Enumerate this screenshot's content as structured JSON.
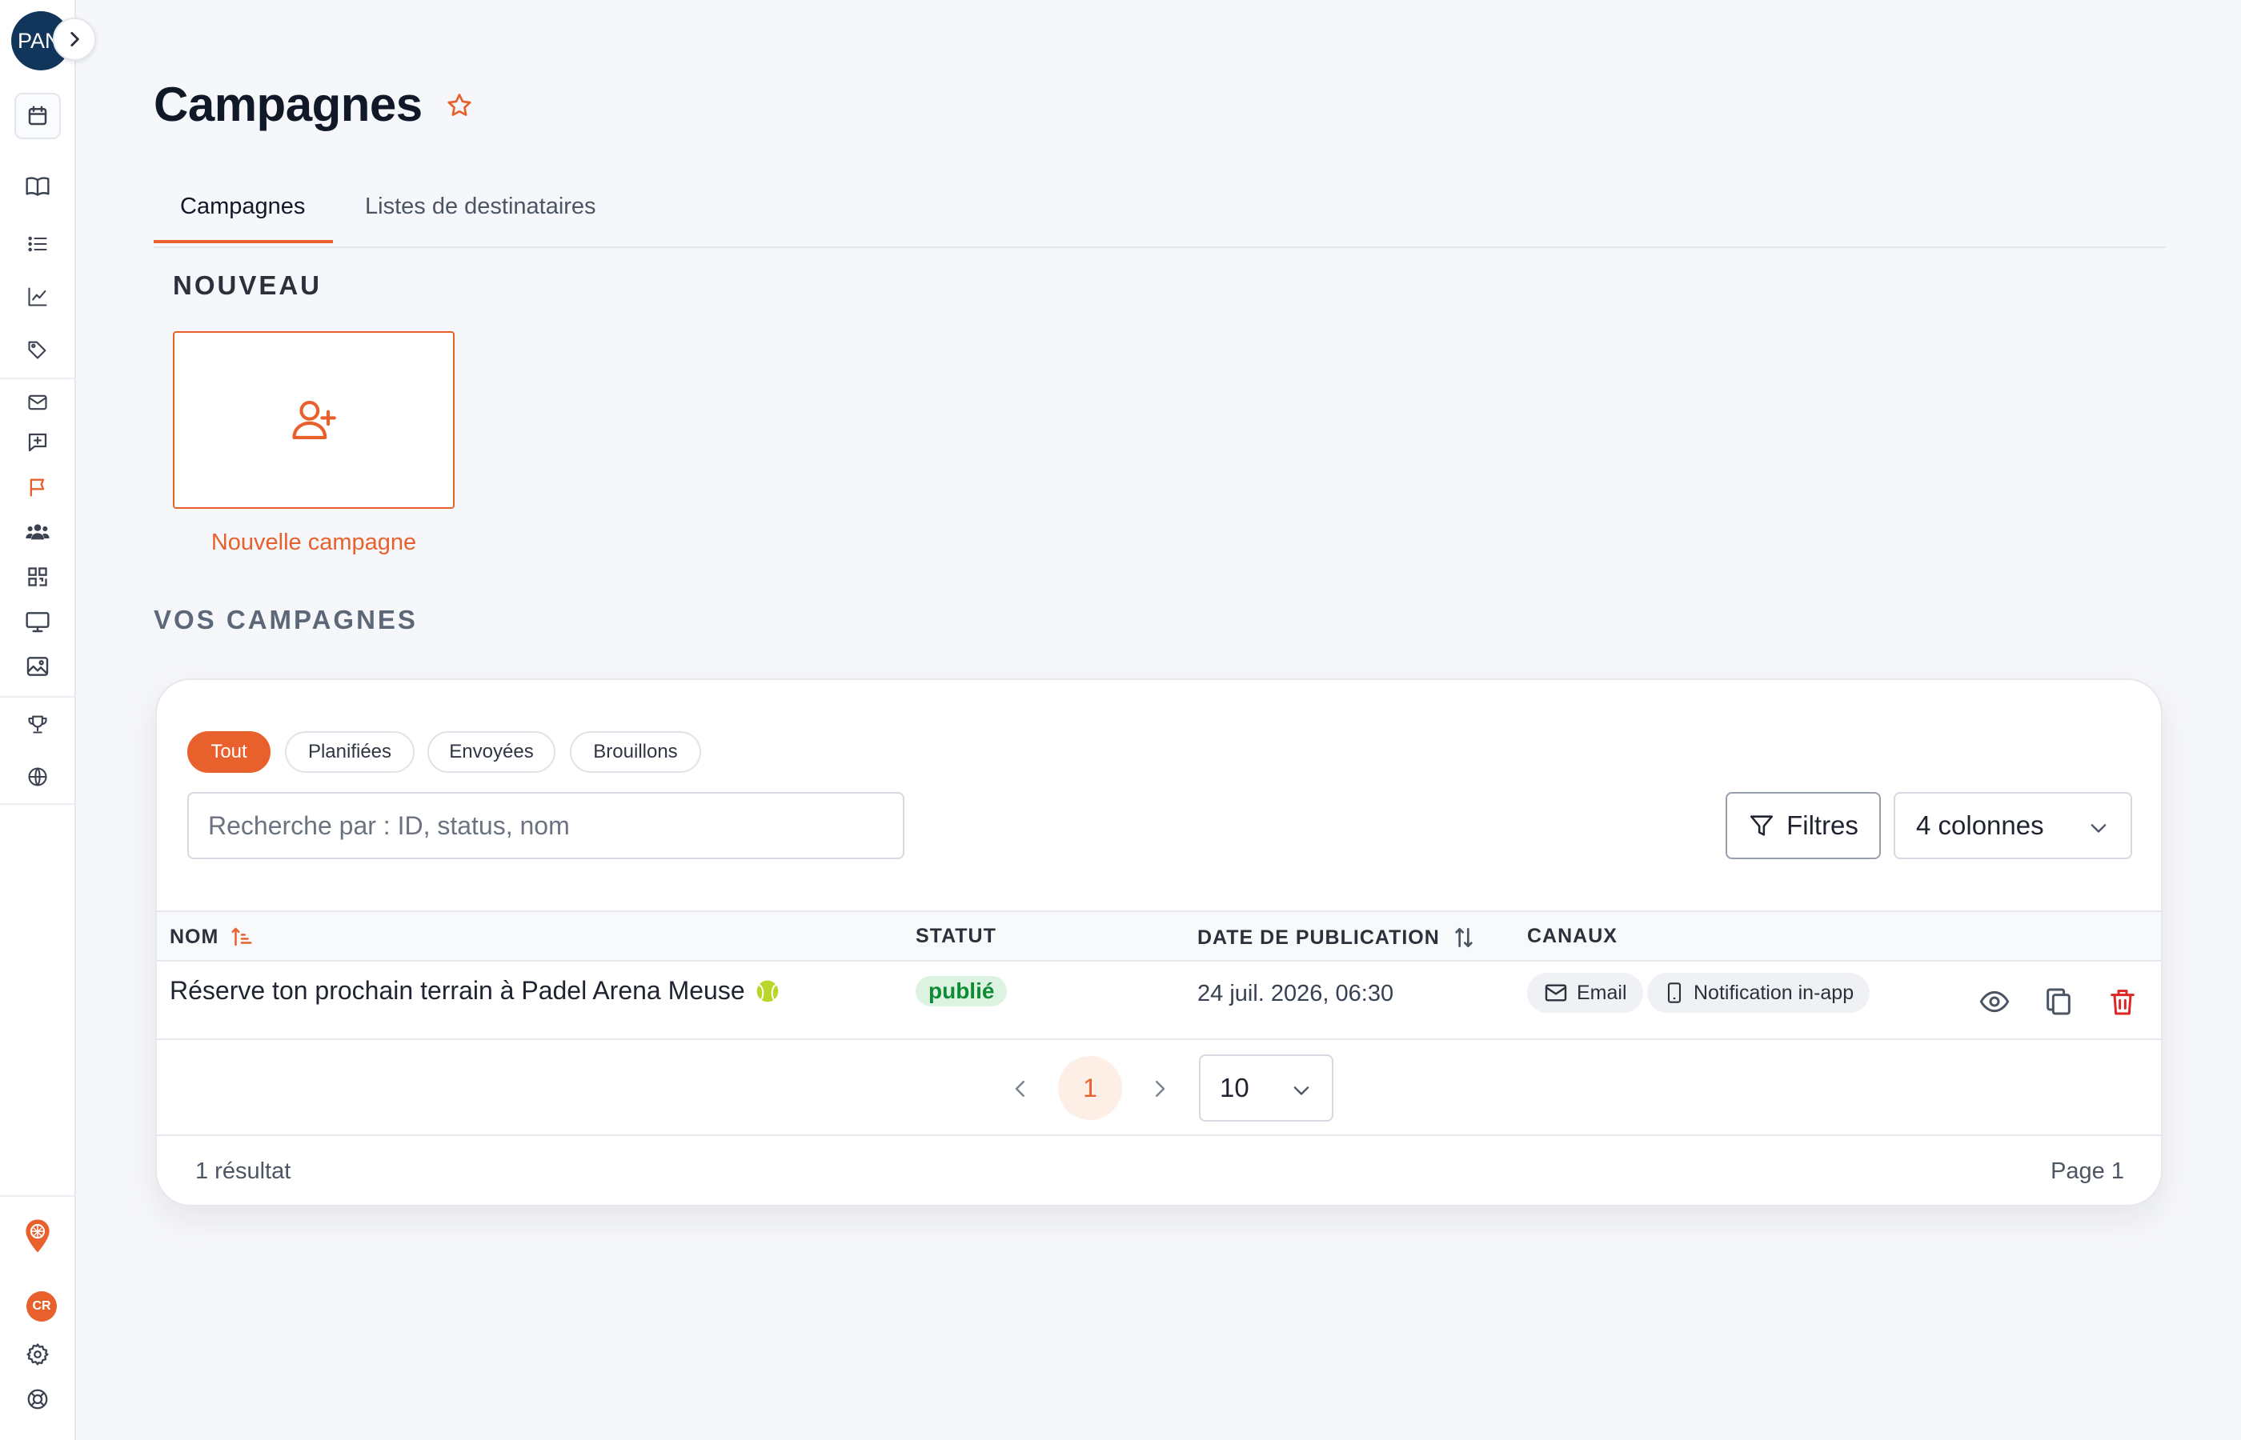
{
  "sidebar": {
    "user_initials": "PAN",
    "bottom_badge": "CR"
  },
  "page": {
    "title": "Campagnes"
  },
  "tabs": [
    {
      "label": "Campagnes",
      "active": true
    },
    {
      "label": "Listes de destinataires",
      "active": false
    }
  ],
  "new_section": {
    "heading": "NOUVEAU",
    "card_label": "Nouvelle campagne"
  },
  "campaigns_section": {
    "heading": "VOS CAMPAGNES",
    "filters": [
      {
        "label": "Tout",
        "active": true
      },
      {
        "label": "Planifiées",
        "active": false
      },
      {
        "label": "Envoyées",
        "active": false
      },
      {
        "label": "Brouillons",
        "active": false
      }
    ],
    "search_placeholder": "Recherche par : ID, status, nom",
    "filters_button": "Filtres",
    "columns_select": "4 colonnes",
    "table": {
      "headers": [
        "NOM",
        "STATUT",
        "DATE DE PUBLICATION",
        "CANAUX"
      ],
      "rows": [
        {
          "name": "Réserve ton prochain terrain à Padel Arena Meuse",
          "status": "publié",
          "date": "24 juil. 2026, 06:30",
          "channels": [
            "Email",
            "Notification in-app"
          ]
        }
      ]
    },
    "pagination": {
      "current_page": "1",
      "per_page": "10"
    },
    "result_count": "1 résultat",
    "page_label": "Page 1"
  },
  "colors": {
    "accent": "#e8602c",
    "navy": "#12365b",
    "status_green": "#0f8a35",
    "danger": "#dc2626"
  },
  "icons": [
    "calendar-icon",
    "book-icon",
    "list-icon",
    "chart-icon",
    "tag-icon",
    "mail-icon",
    "message-plus-icon",
    "flag-icon",
    "users-icon",
    "qr-icon",
    "monitor-icon",
    "image-icon",
    "trophy-icon",
    "globe-icon",
    "location-pin-icon",
    "gear-icon",
    "lifebuoy-icon",
    "star-icon",
    "user-plus-icon",
    "funnel-icon",
    "sort-icon",
    "eye-icon",
    "copy-icon",
    "trash-icon",
    "tennis-ball-icon",
    "phone-icon"
  ]
}
